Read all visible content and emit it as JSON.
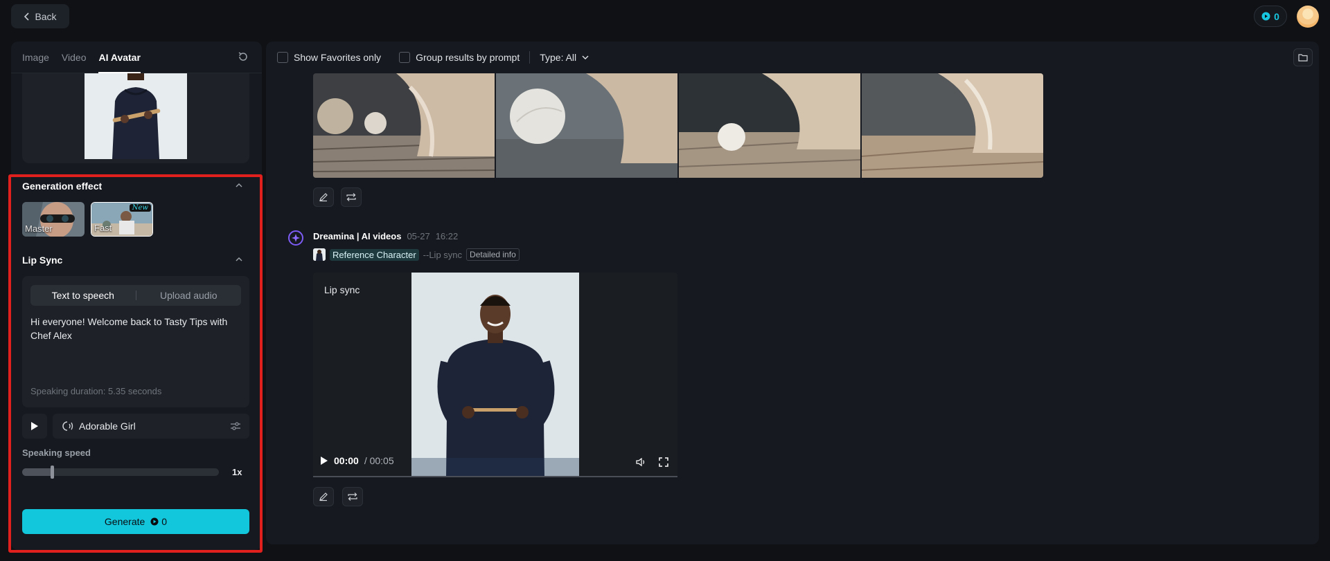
{
  "topbar": {
    "back_label": "Back",
    "credits": "0"
  },
  "left": {
    "tabs": [
      {
        "label": "Image",
        "active": false
      },
      {
        "label": "Video",
        "active": false
      },
      {
        "label": "AI Avatar",
        "active": true
      }
    ],
    "generation_effect": {
      "title": "Generation effect",
      "options": [
        {
          "label": "Master",
          "selected": false
        },
        {
          "label": "Fast",
          "selected": true,
          "badge": "New"
        }
      ]
    },
    "lip_sync": {
      "title": "Lip Sync",
      "modes": [
        "Text to speech",
        "Upload audio"
      ],
      "active_mode": "Text to speech",
      "text": "Hi everyone! Welcome back to Tasty Tips with Chef Alex",
      "duration": "Speaking duration: 5.35 seconds",
      "voice": "Adorable Girl",
      "speed_label": "Speaking speed",
      "speed_value": "1x",
      "speed_level": 0.15
    },
    "generate": {
      "label": "Generate",
      "cost": "0"
    }
  },
  "right": {
    "toolbar": {
      "favorites_label": "Show Favorites only",
      "group_label": "Group results by prompt",
      "type_label": "Type: All"
    },
    "message": {
      "author": "Dreamina | AI videos",
      "date": "05-27",
      "time": "16:22",
      "reference": "Reference Character",
      "mode": "--Lip sync",
      "detail": "Detailed info"
    },
    "video": {
      "label": "Lip sync",
      "current": "00:00",
      "total": "/ 00:05"
    }
  },
  "colors": {
    "accent": "#12c7dc",
    "highlight_frame": "#e0201c",
    "background": "#0f1115",
    "panel": "#16191f"
  }
}
